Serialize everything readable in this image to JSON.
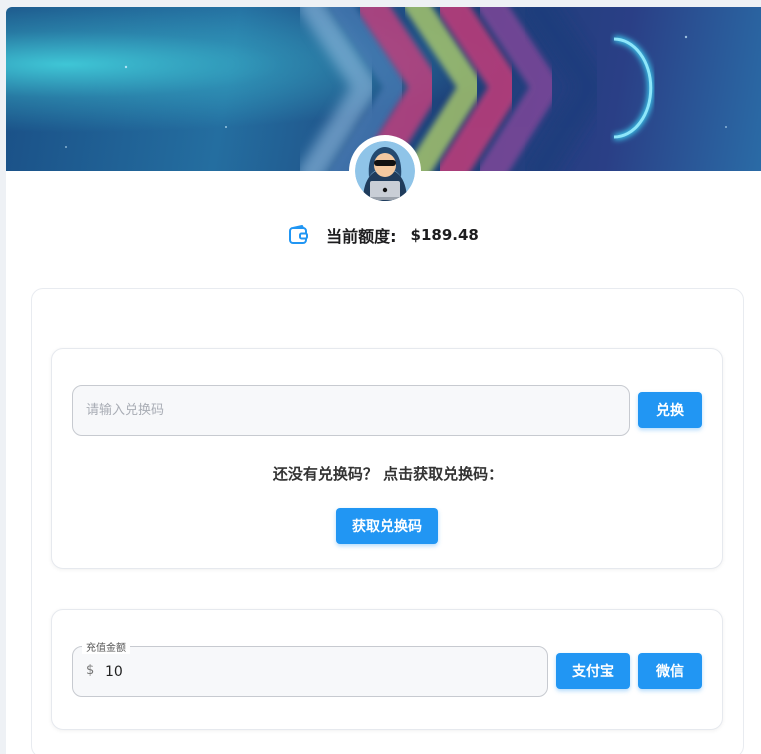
{
  "balance": {
    "label": "当前额度:",
    "value": "$189.48",
    "icon": "wallet-icon"
  },
  "redeem": {
    "input_placeholder": "请输入兑换码",
    "input_value": "",
    "redeem_button": "兑换",
    "prompt": "还没有兑换码？ 点击获取兑换码：",
    "get_code_button": "获取兑换码"
  },
  "recharge": {
    "amount_label": "充值金额",
    "currency_prefix": "$",
    "amount_value": "10",
    "alipay_button": "支付宝",
    "wechat_button": "微信"
  },
  "colors": {
    "accent": "#2196f3",
    "text": "#1d1d1f"
  }
}
